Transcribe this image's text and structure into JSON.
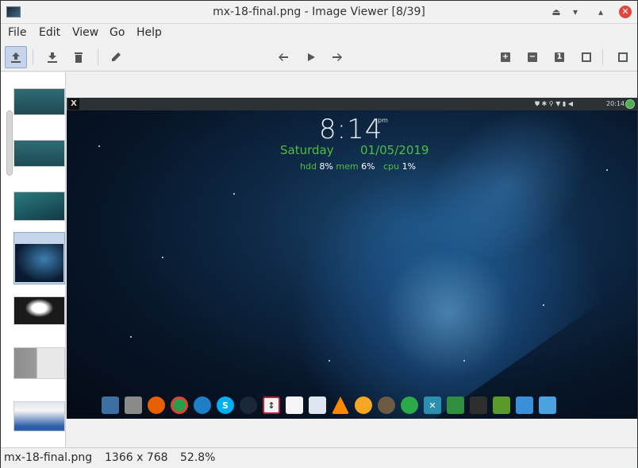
{
  "window": {
    "title": "mx-18-final.png - Image Viewer [8/39]"
  },
  "menu": [
    "File",
    "Edit",
    "View",
    "Go",
    "Help"
  ],
  "toolbar": {
    "zoom_in_glyph": "+",
    "zoom_out_glyph": "−",
    "actual_size_glyph": "1"
  },
  "thumbnails": [
    {
      "name": "thumb-1",
      "selected": false
    },
    {
      "name": "thumb-2",
      "selected": false
    },
    {
      "name": "thumb-3",
      "selected": false
    },
    {
      "name": "thumb-4",
      "selected": true
    },
    {
      "name": "thumb-5",
      "selected": false
    },
    {
      "name": "thumb-6",
      "selected": false
    },
    {
      "name": "thumb-7",
      "selected": false
    }
  ],
  "desktop": {
    "time": "8:14",
    "ampm": "pm",
    "day": "Saturday",
    "date": "01/05/2019",
    "hdd_label": "hdd",
    "hdd_value": "8%",
    "mem_label": "mem",
    "mem_value": "6%",
    "cpu_label": "cpu",
    "cpu_value": "1%",
    "clock": "20:14",
    "mx_logo": "X"
  },
  "status": {
    "filename": "mx-18-final.png",
    "dimensions": "1366 x 768",
    "zoom": "52.8%"
  },
  "colors": {
    "conky_green": "#4fbf3f",
    "selection": "#c5d4ea"
  }
}
